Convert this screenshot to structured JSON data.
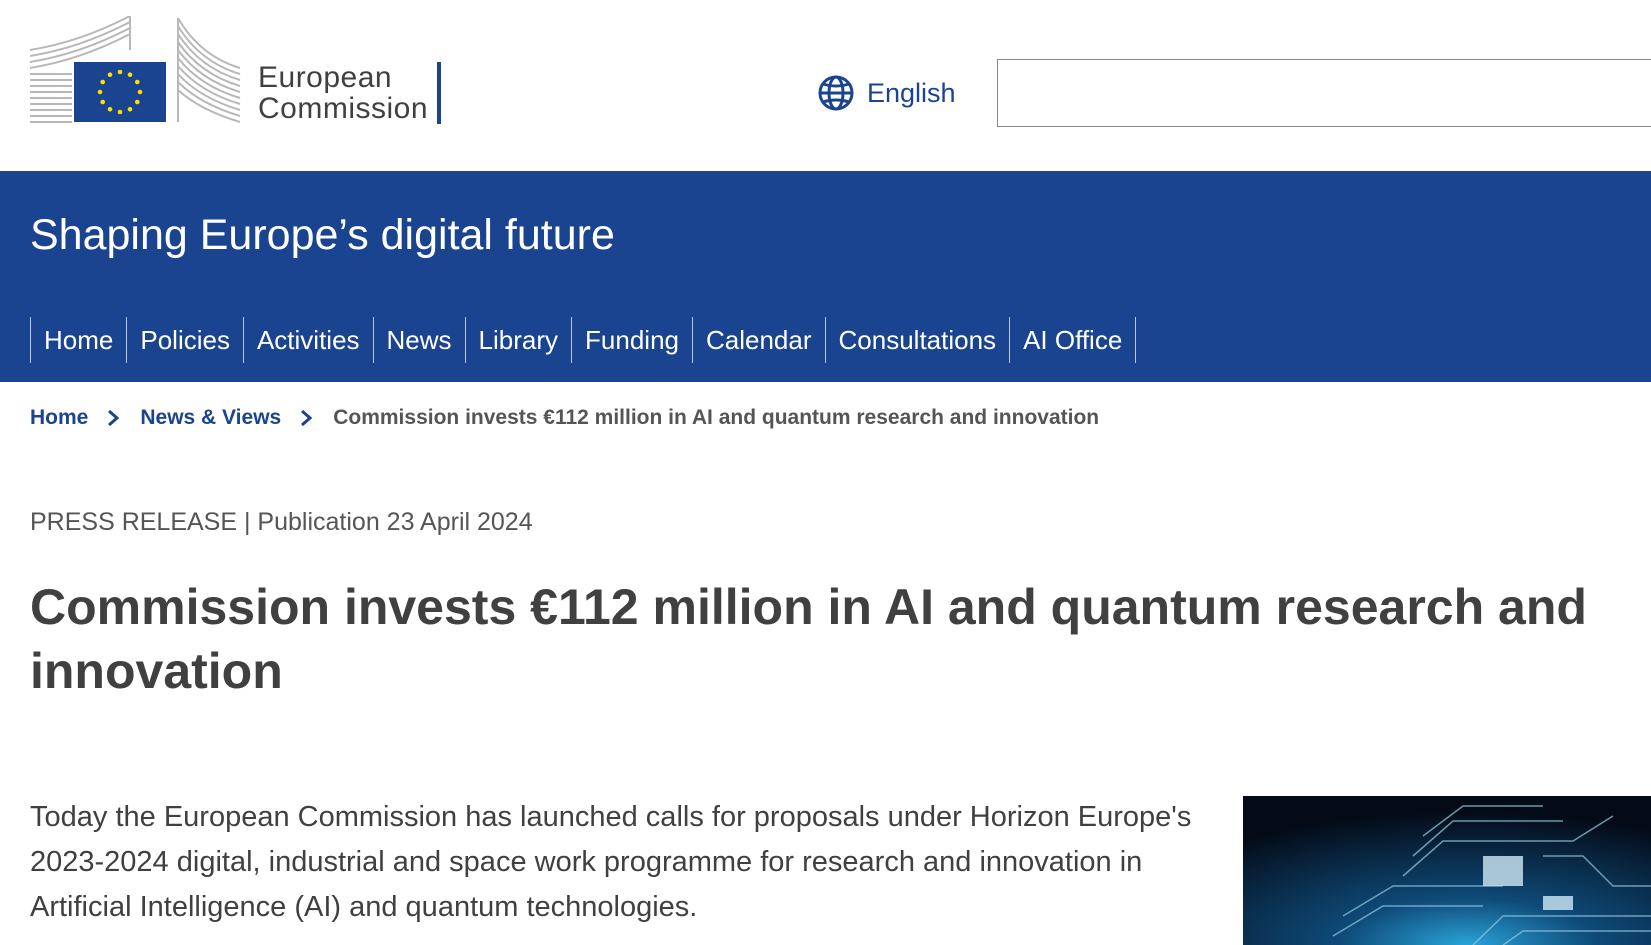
{
  "header": {
    "logo_line1": "European",
    "logo_line2": "Commission",
    "language": "English",
    "language_icon": "globe-icon",
    "search": {
      "value": "",
      "placeholder": ""
    }
  },
  "band": {
    "site_title": "Shaping Europe’s digital future",
    "nav": [
      "Home",
      "Policies",
      "Activities",
      "News",
      "Library",
      "Funding",
      "Calendar",
      "Consultations",
      "AI Office"
    ]
  },
  "breadcrumb": {
    "items": [
      "Home",
      "News & Views"
    ],
    "current": "Commission invests €112 million in AI and quantum research and innovation",
    "separator_icon": "chevron-right-icon"
  },
  "article": {
    "meta": "PRESS RELEASE | Publication 23 April 2024",
    "title": "Commission invests €112 million in AI and quantum research and innovation",
    "lead": "Today the European Commission has launched calls for proposals under Horizon Europe's 2023-2024 digital, industrial and space work programme for research and innovation in Artificial Intelligence (AI) and quantum technologies."
  },
  "colors": {
    "brand_blue": "#1a4490",
    "eu_flag_star": "#ffdd00",
    "text": "#404040"
  }
}
